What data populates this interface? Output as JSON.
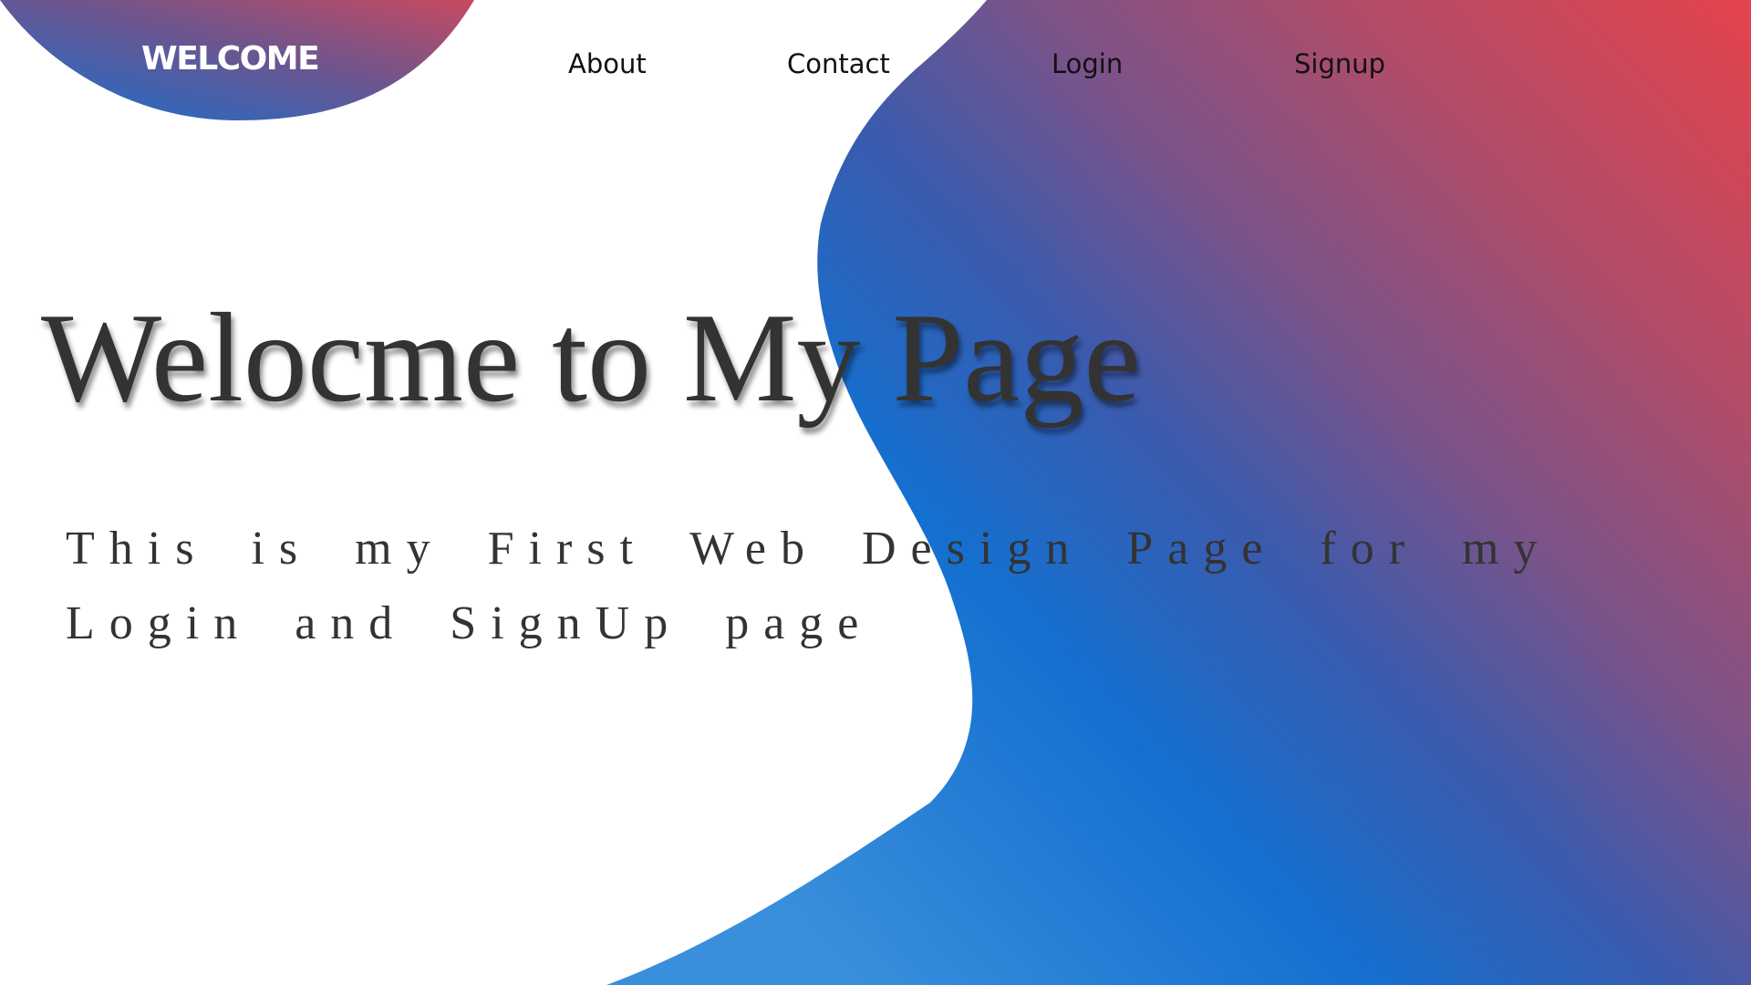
{
  "header": {
    "logo_text": "WELCOME",
    "nav": [
      {
        "label": "About"
      },
      {
        "label": "Contact"
      },
      {
        "label": "Login"
      },
      {
        "label": "Signup"
      }
    ]
  },
  "hero": {
    "title": "Welocme to My Page",
    "subtitle": "This is my First Web Design Page for my Login and SignUp page"
  },
  "colors": {
    "gradient_blue": "#1470d0",
    "gradient_red": "#e4434d",
    "text_dark": "#333333",
    "background": "#ffffff"
  }
}
